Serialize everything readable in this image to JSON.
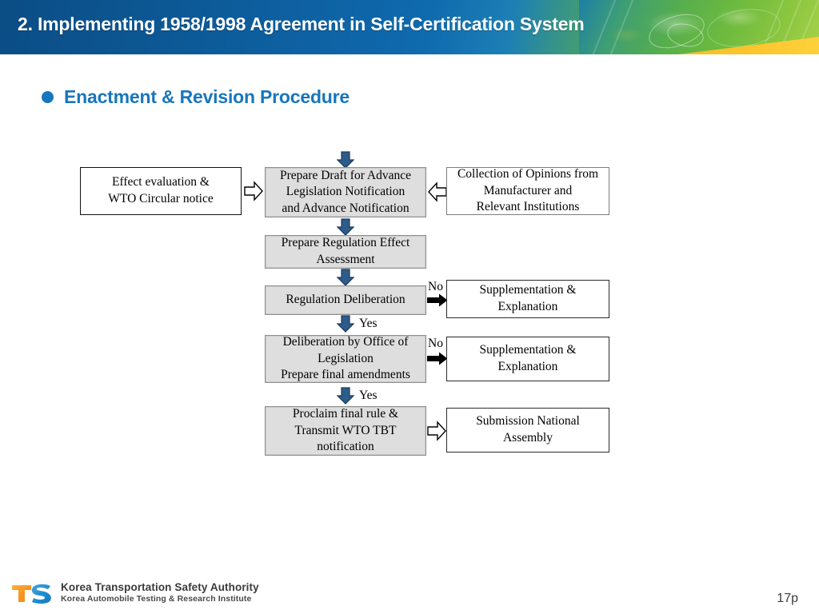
{
  "header": {
    "title": "2. Implementing 1958/1998 Agreement in Self-Certification System",
    "band_color": "#0d5d9c",
    "accent_green": "#6fbb3f",
    "accent_orange": "#f5c02a"
  },
  "section": {
    "bullet_color": "#1876bc",
    "heading": "Enactment & Revision Procedure"
  },
  "flowchart": {
    "nodes": [
      {
        "id": "effect-evaluation",
        "text": "Effect evaluation &\nWTO Circular notice",
        "lines": [
          "Effect evaluation &",
          "WTO Circular notice"
        ],
        "style": "white-thin"
      },
      {
        "id": "prepare-draft",
        "text": "Prepare Draft for Advance Legislation Notification and Advance Notification",
        "lines": [
          "Prepare Draft for Advance",
          "Legislation Notification",
          "and Advance Notification"
        ],
        "style": "gray"
      },
      {
        "id": "collection-opinions",
        "text": "Collection of Opinions from Manufacturer and Relevant Institutions",
        "lines": [
          "Collection of Opinions from",
          "Manufacturer and",
          "Relevant Institutions"
        ],
        "style": "white-gray"
      },
      {
        "id": "regulation-effect-assessment",
        "text": "Prepare Regulation Effect Assessment",
        "lines": [
          "Prepare Regulation Effect",
          "Assessment"
        ],
        "style": "gray"
      },
      {
        "id": "regulation-deliberation",
        "text": "Regulation Deliberation",
        "lines": [
          "Regulation Deliberation"
        ],
        "style": "gray"
      },
      {
        "id": "supplementation-1",
        "text": "Supplementation & Explanation",
        "lines": [
          "Supplementation &",
          "Explanation"
        ],
        "style": "white-dark"
      },
      {
        "id": "deliberation-office-legislation",
        "text": "Deliberation by Office of Legislation Prepare final amendments",
        "lines": [
          "Deliberation by Office of",
          "Legislation",
          "Prepare final amendments"
        ],
        "style": "gray"
      },
      {
        "id": "supplementation-2",
        "text": "Supplementation & Explanation",
        "lines": [
          "Supplementation &",
          "Explanation"
        ],
        "style": "white-dark"
      },
      {
        "id": "proclaim-final-rule",
        "text": "Proclaim final rule & Transmit WTO TBT notification",
        "lines": [
          "Proclaim final rule &",
          "Transmit WTO TBT",
          "notification"
        ],
        "style": "gray"
      },
      {
        "id": "submission-national-assembly",
        "text": "Submission National Assembly",
        "lines": [
          "Submission National",
          "Assembly"
        ],
        "style": "white-dark"
      }
    ],
    "branch_labels": {
      "no_1": "No",
      "yes_1": "Yes",
      "no_2": "No",
      "yes_2": "Yes"
    },
    "arrow_colors": {
      "blue_fill": "#2e5c8a",
      "blue_stroke": "#1b3a5c",
      "black": "#000000",
      "hollow_stroke": "#000000"
    }
  },
  "footer": {
    "logo_initials_t": "T",
    "logo_initials_s": "S",
    "org_line1": "Korea Transportation Safety Authority",
    "org_line2": "Korea  Automobile Testing &  Research  Institute",
    "page_number": "17p"
  }
}
